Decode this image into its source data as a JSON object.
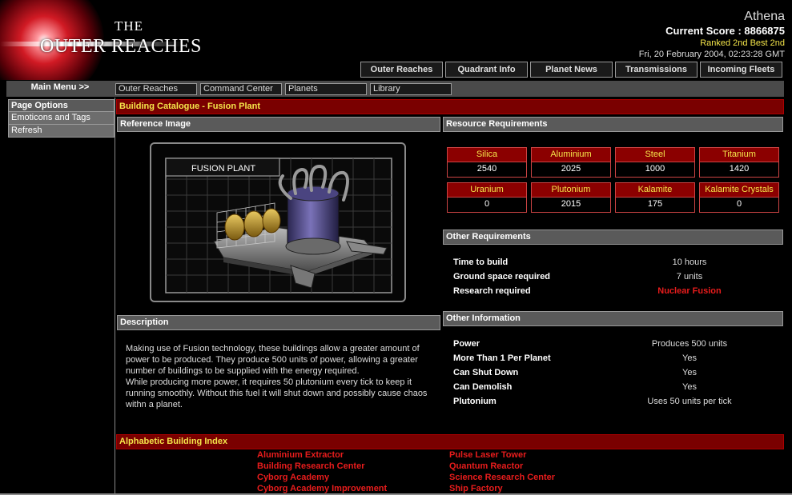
{
  "logo": {
    "the": "THE",
    "name": "OUTER REACHES"
  },
  "user": {
    "name": "Athena",
    "score": "Current Score : 8866875",
    "rank": "Ranked 2nd Best 2nd",
    "datetime": "Fri, 20 February 2004, 02:23:28 GMT"
  },
  "top_nav": [
    "Outer Reaches",
    "Quadrant Info",
    "Planet News",
    "Transmissions",
    "Incoming Fleets"
  ],
  "menu_bar": {
    "main_menu": "Main Menu >>",
    "items": [
      "Outer Reaches",
      "Command Center",
      "Planets",
      "Library"
    ]
  },
  "sidebar": {
    "heading": "Page Options",
    "items": [
      "Emoticons and Tags",
      "Refresh"
    ]
  },
  "content": {
    "title": "Building Catalogue - Fusion Plant",
    "reference_heading": "Reference Image",
    "image_label": "FUSION PLANT",
    "description_heading": "Description",
    "description": [
      "Making use of Fusion technology, these buildings allow a greater amount of",
      "power to be produced. They produce 500 units of power, allowing a greater",
      "number of buildings to be supplied with the energy required.",
      "While producing more power, it requires 50 plutonium every tick to keep it",
      "running smoothly. Without this fuel it will shut down and possibly cause chaos",
      "withn a planet."
    ],
    "resource_heading": "Resource Requirements",
    "resources": [
      {
        "name": "Silica",
        "value": "2540"
      },
      {
        "name": "Aluminium",
        "value": "2025"
      },
      {
        "name": "Steel",
        "value": "1000"
      },
      {
        "name": "Titanium",
        "value": "1420"
      },
      {
        "name": "Uranium",
        "value": "0"
      },
      {
        "name": "Plutonium",
        "value": "2015"
      },
      {
        "name": "Kalamite",
        "value": "175"
      },
      {
        "name": "Kalamite Crystals",
        "value": "0"
      }
    ],
    "other_req_heading": "Other Requirements",
    "other_requirements": [
      {
        "key": "Time to build",
        "value": "10 hours"
      },
      {
        "key": "Ground space required",
        "value": "7 units"
      },
      {
        "key": "Research required",
        "value": "Nuclear Fusion"
      }
    ],
    "other_info_heading": "Other Information",
    "other_info": [
      {
        "key": "Power",
        "value": "Produces 500 units"
      },
      {
        "key": "More Than 1 Per Planet",
        "value": "Yes"
      },
      {
        "key": "Can Shut Down",
        "value": "Yes"
      },
      {
        "key": "Can Demolish",
        "value": "Yes"
      },
      {
        "key": "Plutonium",
        "value": "Uses 50 units per tick"
      }
    ],
    "index_heading": "Alphabetic Building Index",
    "index_col1": [
      "Aluminium Extractor",
      "Building Research Center",
      "Cyborg Academy",
      "Cyborg Academy Improvement"
    ],
    "index_col2": [
      "Pulse Laser Tower",
      "Quantum Reactor",
      "Science Research Center",
      "Ship Factory"
    ]
  }
}
